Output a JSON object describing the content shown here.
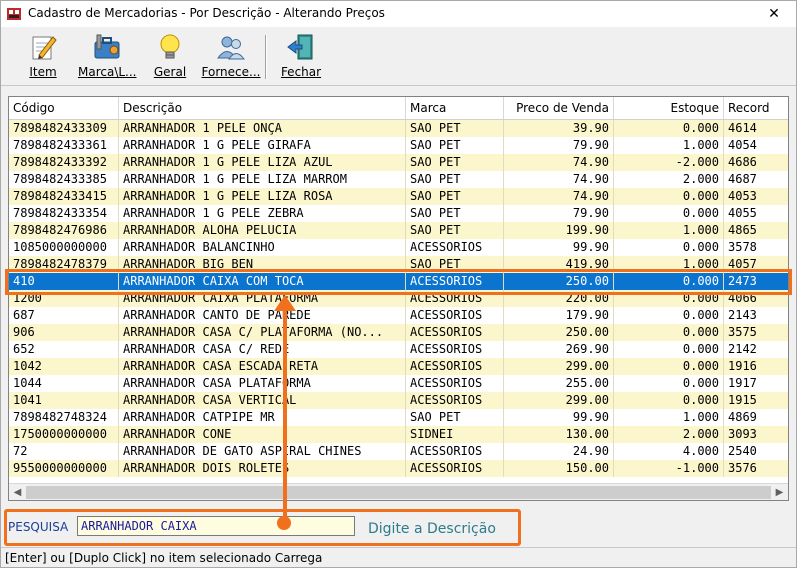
{
  "window": {
    "title": "Cadastro de Mercadorias - Por Descrição - Alterando Preços",
    "close_glyph": "✕"
  },
  "toolbar": {
    "buttons": [
      {
        "label": "Item",
        "icon": "pencil-paper-icon"
      },
      {
        "label": "Marca\\L...",
        "icon": "tools-icon"
      },
      {
        "label": "Geral",
        "icon": "lightbulb-icon"
      },
      {
        "label": "Fornece...",
        "icon": "users-icon"
      },
      {
        "label": "Fechar",
        "icon": "exit-door-icon"
      }
    ]
  },
  "grid": {
    "columns": [
      "Código",
      "Descrição",
      "Marca",
      "Preco de Venda",
      "Estoque",
      "Record"
    ],
    "rows": [
      [
        "7898482433309",
        "ARRANHADOR 1  PELE ONÇA",
        "SAO PET",
        "39.90",
        "0.000",
        "4614"
      ],
      [
        "7898482433361",
        "ARRANHADOR 1 G PELE GIRAFA",
        "SAO PET",
        "79.90",
        "1.000",
        "4054"
      ],
      [
        "7898482433392",
        "ARRANHADOR 1 G PELE LIZA AZUL",
        "SAO PET",
        "74.90",
        "-2.000",
        "4686"
      ],
      [
        "7898482433385",
        "ARRANHADOR 1 G PELE LIZA MARROM",
        "SAO PET",
        "74.90",
        "2.000",
        "4687"
      ],
      [
        "7898482433415",
        "ARRANHADOR 1 G PELE LIZA ROSA",
        "SAO PET",
        "74.90",
        "0.000",
        "4053"
      ],
      [
        "7898482433354",
        "ARRANHADOR 1 G PELE ZEBRA",
        "SAO PET",
        "79.90",
        "0.000",
        "4055"
      ],
      [
        "7898482476986",
        "ARRANHADOR ALOHA PELUCIA",
        "SAO PET",
        "199.90",
        "1.000",
        "4865"
      ],
      [
        "1085000000000",
        "ARRANHADOR BALANCINHO",
        "ACESSORIOS",
        "99.90",
        "0.000",
        "3578"
      ],
      [
        "7898482478379",
        "ARRANHADOR BIG BEN",
        "SAO PET",
        "419.90",
        "1.000",
        "4057"
      ],
      [
        "410",
        "ARRANHADOR CAIXA COM TOCA",
        "ACESSORIOS",
        "250.00",
        "0.000",
        "2473"
      ],
      [
        "1200",
        "ARRANHADOR CAIXA PLATAFORMA",
        "ACESSORIOS",
        "220.00",
        "0.000",
        "4066"
      ],
      [
        "687",
        "ARRANHADOR CANTO DE PAREDE",
        "ACESSORIOS",
        "179.90",
        "0.000",
        "2143"
      ],
      [
        "906",
        "ARRANHADOR CASA C/ PLATAFORMA (NO...",
        "ACESSORIOS",
        "250.00",
        "0.000",
        "3575"
      ],
      [
        "652",
        "ARRANHADOR CASA C/ REDE",
        "ACESSORIOS",
        "269.90",
        "0.000",
        "2142"
      ],
      [
        "1042",
        "ARRANHADOR CASA ESCADA RETA",
        "ACESSORIOS",
        "299.00",
        "0.000",
        "1916"
      ],
      [
        "1044",
        "ARRANHADOR CASA PLATAFORMA",
        "ACESSORIOS",
        "255.00",
        "0.000",
        "1917"
      ],
      [
        "1041",
        "ARRANHADOR CASA VERTICAL",
        "ACESSORIOS",
        "299.00",
        "0.000",
        "1915"
      ],
      [
        "7898482748324",
        "ARRANHADOR CATPIPE MR",
        "SAO PET",
        "99.90",
        "1.000",
        "4869"
      ],
      [
        "1750000000000",
        "ARRANHADOR CONE",
        "SIDNEI",
        "130.00",
        "2.000",
        "3093"
      ],
      [
        "72",
        "ARRANHADOR DE GATO ASPIRAL CHINES",
        "ACESSORIOS",
        "24.90",
        "4.000",
        "2540"
      ],
      [
        "9550000000000",
        "ARRANHADOR DOIS ROLETES",
        "ACESSORIOS",
        "150.00",
        "-1.000",
        "3576"
      ]
    ],
    "selected_index": 9
  },
  "search": {
    "label": "PESQUISA",
    "value": "ARRANHADOR CAIXA",
    "hint": "Digite a Descrição"
  },
  "status": {
    "text": "[Enter] ou [Duplo Click] no item selecionado Carrega"
  },
  "colors": {
    "selection": "#0a74cf",
    "row_alt": "#fbf6cb",
    "highlight": "#f0701e"
  }
}
